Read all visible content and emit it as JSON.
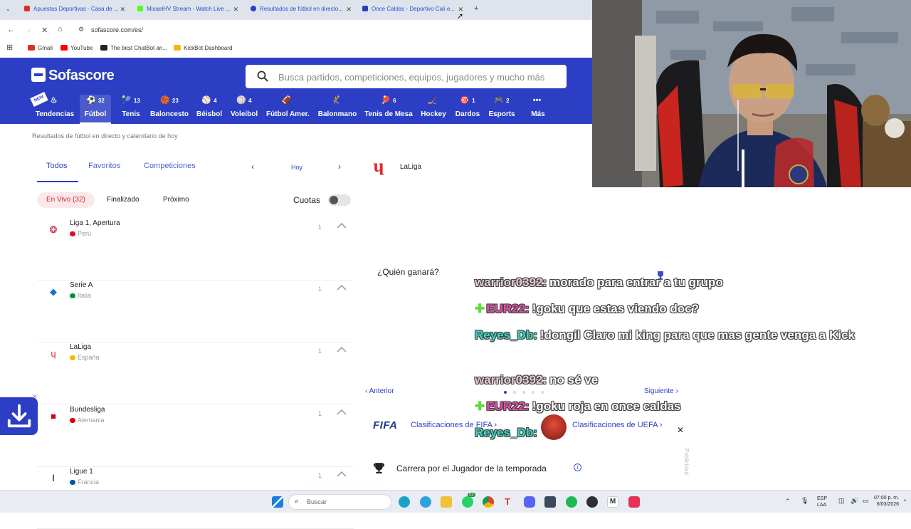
{
  "browser": {
    "tabs": [
      {
        "title": "Apuestas Deportivas - Casa de ...",
        "color": "#d93025"
      },
      {
        "title": "MisaelHV Stream - Watch Live ...",
        "color": "#53fc18"
      },
      {
        "title": "Resultados de fútbol en directo...",
        "color": "#2c3ec4"
      },
      {
        "title": "Once Caldas - Deportivo Cali e...",
        "color": "#2c3ec4"
      }
    ],
    "url": "sofascore.com/es/",
    "bookmarks": [
      {
        "label": "Gmail",
        "color": "#d93025"
      },
      {
        "label": "YouTube",
        "color": "#ff0000"
      },
      {
        "label": "The best ChatBot an...",
        "color": "#222222"
      },
      {
        "label": "KickBot Dashboard",
        "color": "#f2b90c"
      }
    ]
  },
  "header": {
    "logo": "Sofascore",
    "new_badge": "NEW",
    "search_placeholder": "Busca partidos, competiciones, equipos, jugadores y mucho más",
    "sports": [
      {
        "label": "Tendencias",
        "icon": "flame-icon",
        "glyph": "♨",
        "count": ""
      },
      {
        "label": "Fútbol",
        "icon": "soccer-ball-icon",
        "glyph": "⚽",
        "count": "32",
        "active": true
      },
      {
        "label": "Tenis",
        "icon": "tennis-icon",
        "glyph": "🎾",
        "count": "13"
      },
      {
        "label": "Baloncesto",
        "icon": "basketball-icon",
        "glyph": "🏀",
        "count": "23"
      },
      {
        "label": "Béisbol",
        "icon": "baseball-icon",
        "glyph": "⚾",
        "count": "4"
      },
      {
        "label": "Voleibol",
        "icon": "volleyball-icon",
        "glyph": "🏐",
        "count": "4"
      },
      {
        "label": "Fútbol Amer.",
        "icon": "football-icon",
        "glyph": "🏈",
        "count": ""
      },
      {
        "label": "Balonmano",
        "icon": "handball-icon",
        "glyph": "🤾",
        "count": ""
      },
      {
        "label": "Tenis de Mesa",
        "icon": "table-tennis-icon",
        "glyph": "🏓",
        "count": "6"
      },
      {
        "label": "Hockey",
        "icon": "hockey-icon",
        "glyph": "🏒",
        "count": ""
      },
      {
        "label": "Dardos",
        "icon": "darts-icon",
        "glyph": "🎯",
        "count": "1"
      },
      {
        "label": "Esports",
        "icon": "gamepad-icon",
        "glyph": "🎮",
        "count": "2"
      },
      {
        "label": "Más",
        "icon": "more-icon",
        "glyph": "•••",
        "count": ""
      }
    ]
  },
  "breadcrumb": "Resultados de fútbol en directo y calendario de hoy",
  "filters": {
    "tabs": [
      "Todos",
      "Favoritos",
      "Competiciones"
    ],
    "date": "Hoy",
    "live": "En Vivo (32)",
    "finished": "Finalizado",
    "upcoming": "Próximo",
    "odds": "Cuotas"
  },
  "leagues": [
    {
      "name": "Liga 1, Apertura",
      "country": "Perú",
      "count": "1",
      "flag": "#d91023",
      "emblem_color": "#c8102e",
      "glyph": "❂"
    },
    {
      "name": "Serie A",
      "country": "Italia",
      "count": "1",
      "flag": "#009246",
      "emblem_color": "#1d6fd6",
      "glyph": "◆"
    },
    {
      "name": "LaLiga",
      "country": "España",
      "count": "1",
      "flag": "#f1bf00",
      "emblem_color": "#e0282e",
      "glyph": "ɥ"
    },
    {
      "name": "Bundesliga",
      "country": "Alemania",
      "count": "1",
      "flag": "#dd0000",
      "emblem_color": "#d20515",
      "glyph": "■"
    },
    {
      "name": "Ligue 1",
      "country": "Francia",
      "count": "1",
      "flag": "#0055a4",
      "emblem_color": "#111111",
      "glyph": "Ⅰ"
    }
  ],
  "right_panel": {
    "featured_league": "LaLiga",
    "who_wins": "¿Quién ganará?",
    "prev": "Anterior",
    "next": "Siguiente",
    "fifa_logo": "FIFA",
    "fifa_rankings": "Clasificaciones de FIFA",
    "uefa_rankings": "Clasificaciones de UEFA",
    "player_race": "Carrera por el Jugador de la temporada",
    "ad_label": "Publicidad"
  },
  "chat": [
    {
      "user": "warrior0392:",
      "text": "morado para entrar a tu grupo",
      "color": "#e7c9d6",
      "badge": false
    },
    {
      "user": "EUR22:",
      "text": "!goku que estas viendo doc?",
      "color": "#e64aa8",
      "badge": true
    },
    {
      "user": "Reyes_Db:",
      "text": "!dongil Claro mi king para que mas gente venga a Kick",
      "color": "#39d6c4",
      "badge": false
    },
    {
      "user": "warrior0392:",
      "text": "no sé ve",
      "color": "#e7c9d6",
      "badge": false
    },
    {
      "user": "EUR22:",
      "text": "!goku roja en once caldas",
      "color": "#e64aa8",
      "badge": true
    },
    {
      "user": "Reyes_Db:",
      "text": "",
      "color": "#39d6c4",
      "badge": false
    }
  ],
  "taskbar": {
    "search": "Buscar",
    "lang": "ESP",
    "region": "LAA",
    "time": "07:00 p. m.",
    "date": "6/03/2026",
    "whatsapp_badge": "52"
  }
}
